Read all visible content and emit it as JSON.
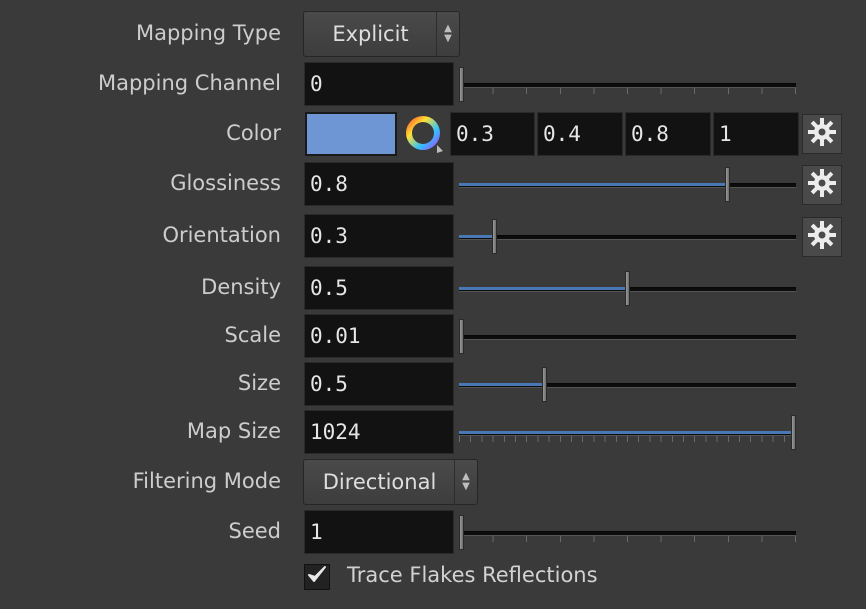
{
  "mapping_type": {
    "label": "Mapping Type",
    "value": "Explicit"
  },
  "mapping_channel": {
    "label": "Mapping Channel",
    "value": "0",
    "level": 0.0
  },
  "color": {
    "label": "Color",
    "swatch": "#6e96d4",
    "r": "0.3",
    "g": "0.4",
    "b": "0.8",
    "a": "1"
  },
  "glossiness": {
    "label": "Glossiness",
    "value": "0.8",
    "level": 0.8
  },
  "orientation": {
    "label": "Orientation",
    "value": "0.3",
    "level": 0.1
  },
  "density": {
    "label": "Density",
    "value": "0.5",
    "level": 0.5
  },
  "scale": {
    "label": "Scale",
    "value": "0.01",
    "level": 0.0
  },
  "size": {
    "label": "Size",
    "value": "0.5",
    "level": 0.25
  },
  "map_size": {
    "label": "Map Size",
    "value": "1024",
    "level": 1.0
  },
  "filtering_mode": {
    "label": "Filtering Mode",
    "value": "Directional"
  },
  "seed": {
    "label": "Seed",
    "value": "1",
    "level": 0.0
  },
  "trace_flakes": {
    "label": "Trace Flakes Reflections",
    "checked": true
  },
  "colors": {
    "accent": "#4a78b5",
    "background": "#3a3a3a",
    "field": "#121212"
  }
}
